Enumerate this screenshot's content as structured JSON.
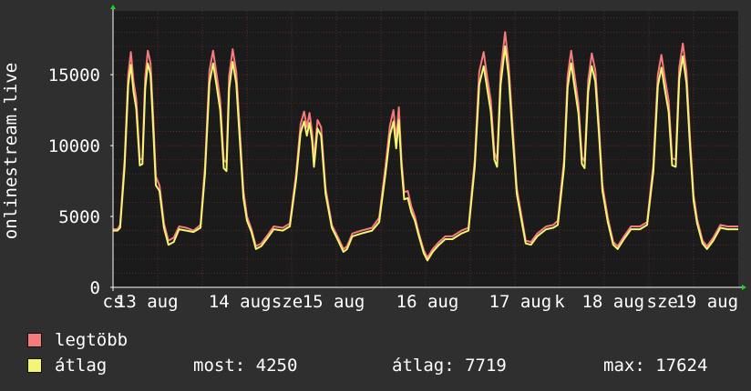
{
  "chart_data": {
    "type": "line",
    "ylabel": "onlinestream.live",
    "ylim": [
      0,
      19500
    ],
    "yticks": [
      0,
      5000,
      10000,
      15000
    ],
    "ytick_labels": [
      "0",
      "5000",
      "10000",
      "15000"
    ],
    "xlim": [
      0,
      7
    ],
    "x_tick_labels": [
      {
        "x": 0.0,
        "text": "cs"
      },
      {
        "x": 0.38,
        "text": "13 aug"
      },
      {
        "x": 1.42,
        "text": "14 aug"
      },
      {
        "x": 1.95,
        "text": "sze"
      },
      {
        "x": 2.47,
        "text": "15 aug"
      },
      {
        "x": 3.52,
        "text": "16 aug"
      },
      {
        "x": 4.56,
        "text": "17 aug"
      },
      {
        "x": 5.0,
        "text": "k"
      },
      {
        "x": 5.6,
        "text": "18 aug"
      },
      {
        "x": 6.15,
        "text": "sze"
      },
      {
        "x": 6.65,
        "text": "19 aug"
      }
    ],
    "x_unit": "days since the left edge of the plot (7-day window)",
    "series": [
      {
        "name": "legtöbb",
        "color": "#f87b7b",
        "points": [
          [
            0.0,
            4100
          ],
          [
            0.05,
            4100
          ],
          [
            0.08,
            4400
          ],
          [
            0.13,
            9000
          ],
          [
            0.17,
            15000
          ],
          [
            0.2,
            16600
          ],
          [
            0.23,
            14500
          ],
          [
            0.26,
            13300
          ],
          [
            0.3,
            9000
          ],
          [
            0.33,
            9100
          ],
          [
            0.36,
            14800
          ],
          [
            0.39,
            16700
          ],
          [
            0.42,
            15800
          ],
          [
            0.45,
            12000
          ],
          [
            0.48,
            7800
          ],
          [
            0.52,
            7200
          ],
          [
            0.57,
            4500
          ],
          [
            0.62,
            3300
          ],
          [
            0.68,
            3500
          ],
          [
            0.74,
            4300
          ],
          [
            0.82,
            4200
          ],
          [
            0.9,
            4000
          ],
          [
            0.98,
            4400
          ],
          [
            1.03,
            8500
          ],
          [
            1.08,
            15300
          ],
          [
            1.12,
            16700
          ],
          [
            1.16,
            15000
          ],
          [
            1.2,
            13200
          ],
          [
            1.24,
            9000
          ],
          [
            1.27,
            8800
          ],
          [
            1.3,
            14900
          ],
          [
            1.34,
            16800
          ],
          [
            1.38,
            15200
          ],
          [
            1.42,
            11000
          ],
          [
            1.46,
            6800
          ],
          [
            1.5,
            5000
          ],
          [
            1.55,
            4100
          ],
          [
            1.6,
            2900
          ],
          [
            1.66,
            3100
          ],
          [
            1.72,
            3600
          ],
          [
            1.8,
            4300
          ],
          [
            1.9,
            4200
          ],
          [
            1.98,
            4500
          ],
          [
            2.05,
            8000
          ],
          [
            2.1,
            11500
          ],
          [
            2.14,
            12400
          ],
          [
            2.17,
            11300
          ],
          [
            2.2,
            12300
          ],
          [
            2.23,
            10900
          ],
          [
            2.25,
            9000
          ],
          [
            2.29,
            11800
          ],
          [
            2.33,
            11300
          ],
          [
            2.38,
            7000
          ],
          [
            2.45,
            4400
          ],
          [
            2.52,
            3500
          ],
          [
            2.58,
            2700
          ],
          [
            2.62,
            2900
          ],
          [
            2.68,
            3800
          ],
          [
            2.78,
            4000
          ],
          [
            2.9,
            4200
          ],
          [
            2.98,
            4900
          ],
          [
            3.05,
            8500
          ],
          [
            3.1,
            11400
          ],
          [
            3.14,
            12500
          ],
          [
            3.17,
            10400
          ],
          [
            3.2,
            12700
          ],
          [
            3.23,
            9000
          ],
          [
            3.26,
            6700
          ],
          [
            3.3,
            6800
          ],
          [
            3.34,
            5700
          ],
          [
            3.38,
            5000
          ],
          [
            3.42,
            3900
          ],
          [
            3.48,
            2600
          ],
          [
            3.52,
            2100
          ],
          [
            3.58,
            2700
          ],
          [
            3.65,
            3200
          ],
          [
            3.72,
            3600
          ],
          [
            3.8,
            3600
          ],
          [
            3.9,
            4000
          ],
          [
            3.98,
            4200
          ],
          [
            4.05,
            9000
          ],
          [
            4.1,
            15200
          ],
          [
            4.15,
            16600
          ],
          [
            4.19,
            14800
          ],
          [
            4.23,
            13200
          ],
          [
            4.27,
            9500
          ],
          [
            4.3,
            9000
          ],
          [
            4.34,
            15200
          ],
          [
            4.39,
            18000
          ],
          [
            4.43,
            15700
          ],
          [
            4.47,
            11700
          ],
          [
            4.52,
            7000
          ],
          [
            4.58,
            4800
          ],
          [
            4.62,
            3300
          ],
          [
            4.68,
            3200
          ],
          [
            4.75,
            3800
          ],
          [
            4.85,
            4300
          ],
          [
            4.93,
            4400
          ],
          [
            4.98,
            4700
          ],
          [
            5.05,
            9000
          ],
          [
            5.09,
            14900
          ],
          [
            5.13,
            16700
          ],
          [
            5.17,
            14800
          ],
          [
            5.21,
            13000
          ],
          [
            5.25,
            9200
          ],
          [
            5.28,
            8900
          ],
          [
            5.32,
            14600
          ],
          [
            5.36,
            16500
          ],
          [
            5.4,
            15300
          ],
          [
            5.44,
            11500
          ],
          [
            5.48,
            7200
          ],
          [
            5.54,
            4900
          ],
          [
            5.6,
            3200
          ],
          [
            5.65,
            2900
          ],
          [
            5.72,
            3600
          ],
          [
            5.8,
            4300
          ],
          [
            5.9,
            4300
          ],
          [
            5.98,
            4600
          ],
          [
            6.05,
            8700
          ],
          [
            6.1,
            15000
          ],
          [
            6.14,
            16400
          ],
          [
            6.18,
            14700
          ],
          [
            6.22,
            13200
          ],
          [
            6.26,
            9100
          ],
          [
            6.3,
            9000
          ],
          [
            6.34,
            15500
          ],
          [
            6.38,
            17200
          ],
          [
            6.42,
            15200
          ],
          [
            6.46,
            10500
          ],
          [
            6.5,
            6500
          ],
          [
            6.54,
            4800
          ],
          [
            6.6,
            3300
          ],
          [
            6.65,
            2900
          ],
          [
            6.72,
            3500
          ],
          [
            6.8,
            4400
          ],
          [
            6.88,
            4300
          ],
          [
            7.0,
            4300
          ]
        ]
      },
      {
        "name": "átlag",
        "color": "#f5f574",
        "points": [
          [
            0.0,
            4000
          ],
          [
            0.05,
            4000
          ],
          [
            0.08,
            4200
          ],
          [
            0.13,
            8500
          ],
          [
            0.17,
            14300
          ],
          [
            0.2,
            15700
          ],
          [
            0.23,
            13800
          ],
          [
            0.26,
            12600
          ],
          [
            0.3,
            8600
          ],
          [
            0.33,
            8700
          ],
          [
            0.36,
            14000
          ],
          [
            0.39,
            15800
          ],
          [
            0.42,
            15000
          ],
          [
            0.45,
            11200
          ],
          [
            0.48,
            7200
          ],
          [
            0.52,
            6800
          ],
          [
            0.57,
            4200
          ],
          [
            0.62,
            3000
          ],
          [
            0.68,
            3200
          ],
          [
            0.74,
            4100
          ],
          [
            0.82,
            4000
          ],
          [
            0.9,
            3900
          ],
          [
            0.98,
            4200
          ],
          [
            1.03,
            8000
          ],
          [
            1.08,
            14400
          ],
          [
            1.12,
            15800
          ],
          [
            1.16,
            14200
          ],
          [
            1.2,
            12500
          ],
          [
            1.24,
            8400
          ],
          [
            1.27,
            8200
          ],
          [
            1.3,
            14000
          ],
          [
            1.34,
            15900
          ],
          [
            1.38,
            14400
          ],
          [
            1.42,
            10300
          ],
          [
            1.46,
            6300
          ],
          [
            1.5,
            4700
          ],
          [
            1.55,
            3900
          ],
          [
            1.6,
            2700
          ],
          [
            1.66,
            2900
          ],
          [
            1.72,
            3400
          ],
          [
            1.8,
            4100
          ],
          [
            1.9,
            4000
          ],
          [
            1.98,
            4300
          ],
          [
            2.05,
            7600
          ],
          [
            2.1,
            10900
          ],
          [
            2.14,
            11700
          ],
          [
            2.17,
            10700
          ],
          [
            2.2,
            11600
          ],
          [
            2.23,
            10300
          ],
          [
            2.25,
            8500
          ],
          [
            2.29,
            11200
          ],
          [
            2.33,
            10700
          ],
          [
            2.38,
            6600
          ],
          [
            2.45,
            4200
          ],
          [
            2.52,
            3300
          ],
          [
            2.58,
            2500
          ],
          [
            2.62,
            2700
          ],
          [
            2.68,
            3600
          ],
          [
            2.78,
            3800
          ],
          [
            2.9,
            4000
          ],
          [
            2.98,
            4600
          ],
          [
            3.05,
            8000
          ],
          [
            3.1,
            10700
          ],
          [
            3.14,
            11700
          ],
          [
            3.17,
            9800
          ],
          [
            3.2,
            11800
          ],
          [
            3.23,
            8500
          ],
          [
            3.26,
            6200
          ],
          [
            3.3,
            6300
          ],
          [
            3.34,
            5300
          ],
          [
            3.38,
            4700
          ],
          [
            3.42,
            3700
          ],
          [
            3.48,
            2400
          ],
          [
            3.52,
            1900
          ],
          [
            3.58,
            2500
          ],
          [
            3.65,
            3000
          ],
          [
            3.72,
            3400
          ],
          [
            3.8,
            3400
          ],
          [
            3.9,
            3800
          ],
          [
            3.98,
            4000
          ],
          [
            4.05,
            8500
          ],
          [
            4.1,
            14300
          ],
          [
            4.15,
            15600
          ],
          [
            4.19,
            14000
          ],
          [
            4.23,
            12400
          ],
          [
            4.27,
            9000
          ],
          [
            4.3,
            8500
          ],
          [
            4.34,
            14300
          ],
          [
            4.39,
            17000
          ],
          [
            4.43,
            14900
          ],
          [
            4.47,
            11000
          ],
          [
            4.52,
            6600
          ],
          [
            4.58,
            4500
          ],
          [
            4.62,
            3100
          ],
          [
            4.68,
            3000
          ],
          [
            4.75,
            3600
          ],
          [
            4.85,
            4100
          ],
          [
            4.93,
            4200
          ],
          [
            4.98,
            4400
          ],
          [
            5.05,
            8500
          ],
          [
            5.09,
            14100
          ],
          [
            5.13,
            15800
          ],
          [
            5.17,
            14000
          ],
          [
            5.21,
            12300
          ],
          [
            5.25,
            8700
          ],
          [
            5.28,
            8400
          ],
          [
            5.32,
            13800
          ],
          [
            5.36,
            15600
          ],
          [
            5.4,
            14500
          ],
          [
            5.44,
            10900
          ],
          [
            5.48,
            6800
          ],
          [
            5.54,
            4600
          ],
          [
            5.6,
            3000
          ],
          [
            5.65,
            2700
          ],
          [
            5.72,
            3400
          ],
          [
            5.8,
            4100
          ],
          [
            5.9,
            4100
          ],
          [
            5.98,
            4400
          ],
          [
            6.05,
            8200
          ],
          [
            6.1,
            14200
          ],
          [
            6.14,
            15500
          ],
          [
            6.18,
            13900
          ],
          [
            6.22,
            12400
          ],
          [
            6.26,
            8600
          ],
          [
            6.3,
            8500
          ],
          [
            6.34,
            14700
          ],
          [
            6.38,
            16300
          ],
          [
            6.42,
            14400
          ],
          [
            6.46,
            9900
          ],
          [
            6.5,
            6100
          ],
          [
            6.54,
            4500
          ],
          [
            6.6,
            3100
          ],
          [
            6.65,
            2700
          ],
          [
            6.72,
            3300
          ],
          [
            6.8,
            4200
          ],
          [
            6.88,
            4100
          ],
          [
            7.0,
            4100
          ]
        ]
      }
    ],
    "grid": true,
    "background": "#1b1b1b",
    "grid_color": "#5a2a2a",
    "axis_color": "#ffffff",
    "arrow_color": "#20d020"
  },
  "legend": {
    "max_label": "legtöbb",
    "avg_label": "átlag",
    "max_color": "#f87b7b",
    "avg_color": "#f5f574",
    "now_text": "most: 4250",
    "avg_text": "átlag: 7719",
    "max_text": "max: 17624"
  }
}
